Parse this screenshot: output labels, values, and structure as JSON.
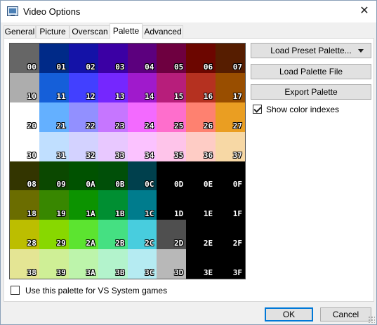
{
  "window": {
    "title": "Video Options",
    "close_glyph": "✕",
    "icon": "video-options-app-icon"
  },
  "tabs": [
    {
      "label": "General",
      "active": false
    },
    {
      "label": "Picture",
      "active": false
    },
    {
      "label": "Overscan",
      "active": false
    },
    {
      "label": "Palette",
      "active": true
    },
    {
      "label": "Advanced",
      "active": false
    }
  ],
  "buttons": {
    "load_preset": "Load Preset Palette...",
    "load_file": "Load Palette File",
    "export": "Export Palette",
    "ok": "OK",
    "cancel": "Cancel"
  },
  "checkboxes": {
    "show_color_indexes": {
      "label": "Show color indexes",
      "checked": true
    },
    "vs_system": {
      "label": "Use this palette for VS System games",
      "checked": false
    }
  },
  "palette": [
    {
      "index": "00",
      "color": "#666666"
    },
    {
      "index": "01",
      "color": "#002a88"
    },
    {
      "index": "02",
      "color": "#1412a7"
    },
    {
      "index": "03",
      "color": "#3b00a4"
    },
    {
      "index": "04",
      "color": "#5c007e"
    },
    {
      "index": "05",
      "color": "#6e0040"
    },
    {
      "index": "06",
      "color": "#6c0600"
    },
    {
      "index": "07",
      "color": "#561d00"
    },
    {
      "index": "10",
      "color": "#adadad"
    },
    {
      "index": "11",
      "color": "#155fd9"
    },
    {
      "index": "12",
      "color": "#4240ff"
    },
    {
      "index": "13",
      "color": "#7527fe"
    },
    {
      "index": "14",
      "color": "#a01acc"
    },
    {
      "index": "15",
      "color": "#b71e7b"
    },
    {
      "index": "16",
      "color": "#b53120"
    },
    {
      "index": "17",
      "color": "#994e00"
    },
    {
      "index": "20",
      "color": "#ffffff"
    },
    {
      "index": "21",
      "color": "#64b0ff"
    },
    {
      "index": "22",
      "color": "#9290ff"
    },
    {
      "index": "23",
      "color": "#c676ff"
    },
    {
      "index": "24",
      "color": "#f36aff"
    },
    {
      "index": "25",
      "color": "#fe6ecc"
    },
    {
      "index": "26",
      "color": "#fe8170"
    },
    {
      "index": "27",
      "color": "#ea9e22"
    },
    {
      "index": "30",
      "color": "#ffffff"
    },
    {
      "index": "31",
      "color": "#c0dfff"
    },
    {
      "index": "32",
      "color": "#d3d2ff"
    },
    {
      "index": "33",
      "color": "#e8c8ff"
    },
    {
      "index": "34",
      "color": "#fbc2ff"
    },
    {
      "index": "35",
      "color": "#fec4ea"
    },
    {
      "index": "36",
      "color": "#feccc5"
    },
    {
      "index": "37",
      "color": "#f7d8a5"
    },
    {
      "index": "08",
      "color": "#333500"
    },
    {
      "index": "09",
      "color": "#0b4800"
    },
    {
      "index": "0A",
      "color": "#005200"
    },
    {
      "index": "0B",
      "color": "#004f08"
    },
    {
      "index": "0C",
      "color": "#00404d"
    },
    {
      "index": "0D",
      "color": "#000000"
    },
    {
      "index": "0E",
      "color": "#000000"
    },
    {
      "index": "0F",
      "color": "#000000"
    },
    {
      "index": "18",
      "color": "#6b6d00"
    },
    {
      "index": "19",
      "color": "#388700"
    },
    {
      "index": "1A",
      "color": "#0c9300"
    },
    {
      "index": "1B",
      "color": "#008f32"
    },
    {
      "index": "1C",
      "color": "#007c8d"
    },
    {
      "index": "1D",
      "color": "#000000"
    },
    {
      "index": "1E",
      "color": "#000000"
    },
    {
      "index": "1F",
      "color": "#000000"
    },
    {
      "index": "28",
      "color": "#bcbe00"
    },
    {
      "index": "29",
      "color": "#88d800"
    },
    {
      "index": "2A",
      "color": "#5ce430"
    },
    {
      "index": "2B",
      "color": "#45e082"
    },
    {
      "index": "2C",
      "color": "#48cdde"
    },
    {
      "index": "2D",
      "color": "#4f4f4f"
    },
    {
      "index": "2E",
      "color": "#000000"
    },
    {
      "index": "2F",
      "color": "#000000"
    },
    {
      "index": "38",
      "color": "#e4e594"
    },
    {
      "index": "39",
      "color": "#cfef96"
    },
    {
      "index": "3A",
      "color": "#bdf4ab"
    },
    {
      "index": "3B",
      "color": "#b3f3cc"
    },
    {
      "index": "3C",
      "color": "#b5ebf2"
    },
    {
      "index": "3D",
      "color": "#b8b8b8"
    },
    {
      "index": "3E",
      "color": "#000000"
    },
    {
      "index": "3F",
      "color": "#000000"
    }
  ]
}
